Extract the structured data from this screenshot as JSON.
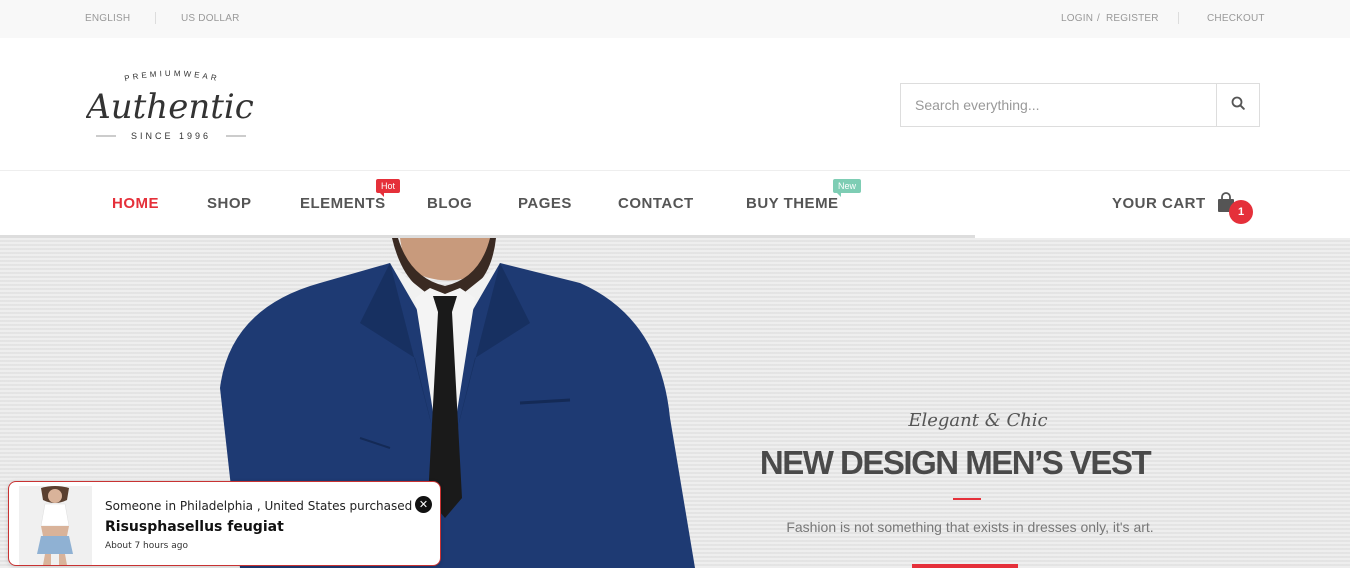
{
  "topbar": {
    "language": "ENGLISH",
    "currency": "US DOLLAR",
    "login": "LOGIN",
    "login_sep": "/",
    "register": "REGISTER",
    "checkout": "CHECKOUT"
  },
  "logo": {
    "top_text": "PREMIUMWEAR",
    "name": "Authentic",
    "since": "SINCE 1996"
  },
  "search": {
    "placeholder": "Search everything...",
    "icon": "search-icon"
  },
  "nav": {
    "items": [
      {
        "label": "HOME",
        "active": true
      },
      {
        "label": "SHOP"
      },
      {
        "label": "ELEMENTS",
        "badge": "Hot"
      },
      {
        "label": "BLOG"
      },
      {
        "label": "PAGES"
      },
      {
        "label": "CONTACT"
      },
      {
        "label": "BUY THEME",
        "badge": "New"
      }
    ],
    "cart_label": "YOUR CART",
    "cart_icon": "shopping-bag-icon",
    "cart_count": "1"
  },
  "hero": {
    "script": "Elegant & Chic",
    "title": "NEW DESIGN MEN’S VEST",
    "tagline": "Fashion is not something that exists in dresses only, it's art."
  },
  "popup": {
    "line1": "Someone in Philadelphia , United States purchased a",
    "product": "Risusphasellus feugiat",
    "time": "About 7 hours ago",
    "close_icon": "close-icon"
  },
  "colors": {
    "accent": "#e5303a",
    "new_badge": "#7ecdb4",
    "text": "#555555"
  }
}
